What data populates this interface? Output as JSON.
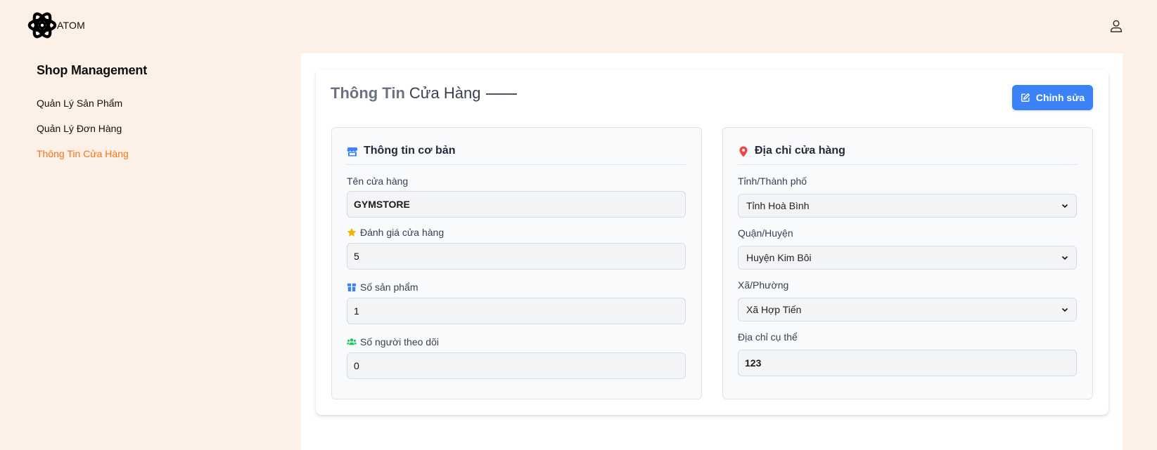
{
  "brand": {
    "name": "ATOM"
  },
  "icons": {
    "logo": "atom-logo-icon",
    "user": "user-icon",
    "edit": "edit-icon",
    "store": "store-icon",
    "location": "map-pin-icon",
    "star": "star-icon",
    "box": "box-icon",
    "users": "users-icon",
    "chevron": "chevron-down-icon"
  },
  "colors": {
    "background": "#fdf0e7",
    "accent_active": "#f97316",
    "primary_button": "#3b82f6",
    "store_icon": "#3b82f6",
    "pin_icon": "#ef4444",
    "star_icon": "#f5b400",
    "users_icon": "#22c55e"
  },
  "sidebar": {
    "title": "Shop Management",
    "items": [
      {
        "label": "Quản Lý Sản Phẩm",
        "active": false
      },
      {
        "label": "Quản Lý Đơn Hàng",
        "active": false
      },
      {
        "label": "Thông Tin Cửa Hàng",
        "active": true
      }
    ]
  },
  "page": {
    "title_part1": "Thông Tin",
    "title_part2": "Cửa Hàng",
    "edit_label": "Chỉnh sửa"
  },
  "basic_info": {
    "heading": "Thông tin cơ bản",
    "store_name_label": "Tên cửa hàng",
    "store_name_value": "GYMSTORE",
    "rating_label": "Đánh giá cửa hàng",
    "rating_value": "5",
    "products_label": "Số sản phẩm",
    "products_value": "1",
    "followers_label": "Số người theo dõi",
    "followers_value": "0"
  },
  "address": {
    "heading": "Địa chỉ cửa hàng",
    "province_label": "Tỉnh/Thành phố",
    "province_value": "Tỉnh Hoà Bình",
    "district_label": "Quận/Huyện",
    "district_value": "Huyện Kim Bôi",
    "ward_label": "Xã/Phường",
    "ward_value": "Xã Hợp Tiến",
    "detail_label": "Địa chỉ cụ thể",
    "detail_value": "123"
  }
}
